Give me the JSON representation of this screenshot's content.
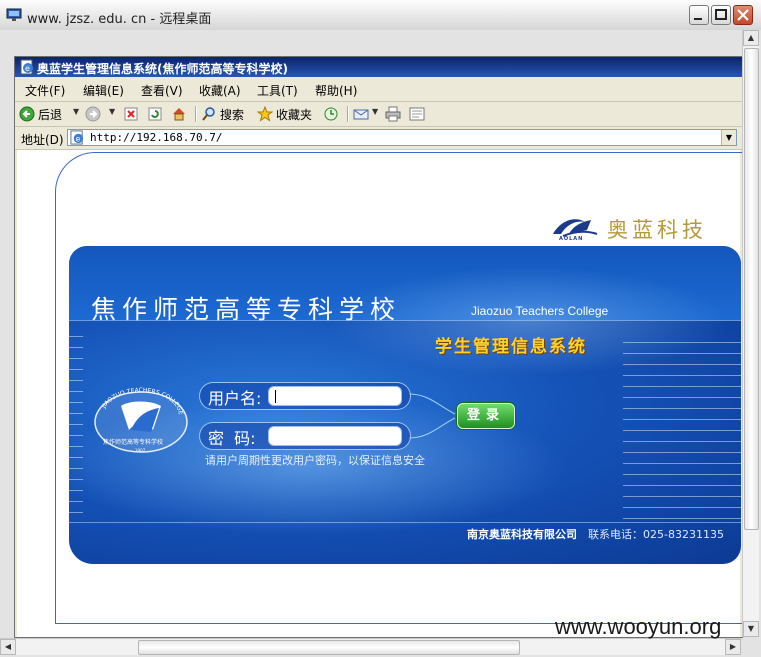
{
  "outer_window": {
    "title": "www. jzsz. edu. cn - 远程桌面"
  },
  "browser": {
    "title": "奥蓝学生管理信息系统(焦作师范高等专科学校)",
    "menu": [
      "文件(F)",
      "编辑(E)",
      "查看(V)",
      "收藏(A)",
      "工具(T)",
      "帮助(H)"
    ],
    "toolbar": {
      "back_label": "后退",
      "search_label": "搜索",
      "favorites_label": "收藏夹"
    },
    "address": {
      "label": "地址(D)",
      "url": "http://192.168.70.7/"
    }
  },
  "page": {
    "brand_name": "奥蓝科技",
    "brand_sub": "AOLAN",
    "school_name_cn": "焦作师范高等专科学校",
    "school_name_en": "Jiaozuo Teachers College",
    "system_name": "学生管理信息系统",
    "login": {
      "username_label": "用户名:",
      "password_label": "密  码:",
      "username_value": "",
      "password_value": "",
      "submit_label": "登录",
      "tip": "请用户周期性更改用户密码，以保证信息安全"
    },
    "footer": {
      "company": "南京奥蓝科技有限公司",
      "phone": "联系电话：025-83231135"
    },
    "school_logo": {
      "top_text": "JIAOZUO TEACHERS COLLEGE",
      "bottom_text": "焦作师范高等专科学校",
      "year": "1907"
    }
  },
  "watermark": "www.wooyun.org"
}
